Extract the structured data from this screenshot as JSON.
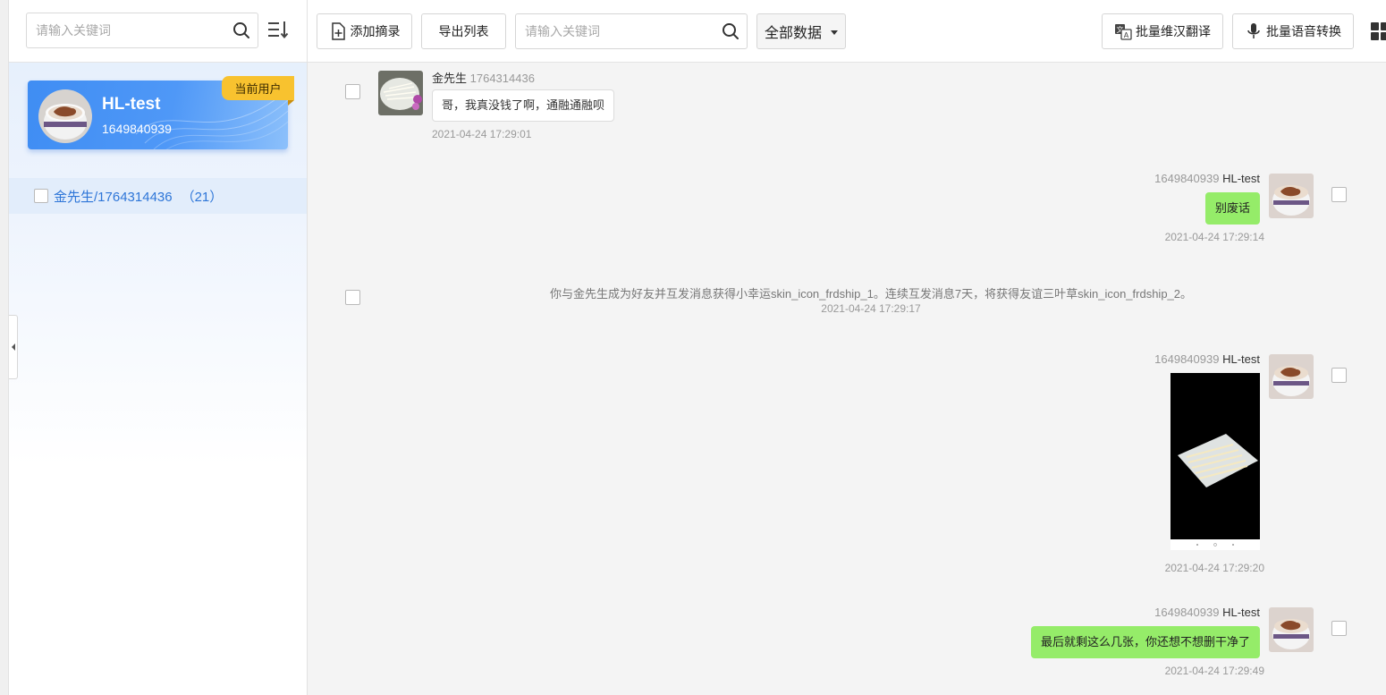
{
  "sidebar": {
    "search_placeholder": "请输入关键词",
    "current_user": {
      "name": "HL-test",
      "id": "1649840939",
      "badge": "当前用户"
    },
    "contacts": [
      {
        "label": "金先生/1764314436",
        "count": "（21）"
      }
    ]
  },
  "toolbar": {
    "add_excerpt": "添加摘录",
    "export_list": "导出列表",
    "search_placeholder": "请输入关键词",
    "filter_selected": "全部数据",
    "batch_translate": "批量维汉翻译",
    "batch_voice": "批量语音转换"
  },
  "messages": {
    "m1": {
      "sender_name": "金先生",
      "sender_id": "1764314436",
      "text": "哥，我真没钱了啊，通融通融呗",
      "time": "2021-04-24 17:29:01"
    },
    "m2": {
      "sender_id": "1649840939",
      "sender_name": "HL-test",
      "text": "别废话",
      "time": "2021-04-24 17:29:14"
    },
    "m3": {
      "text": "你与金先生成为好友并互发消息获得小幸运skin_icon_frdship_1。连续互发消息7天，将获得友谊三叶草skin_icon_frdship_2。",
      "time": "2021-04-24 17:29:17"
    },
    "m4": {
      "sender_id": "1649840939",
      "sender_name": "HL-test",
      "time": "2021-04-24 17:29:20"
    },
    "m5": {
      "sender_id": "1649840939",
      "sender_name": "HL-test",
      "text": "最后就剩这么几张，你还想不想删干净了",
      "time": "2021-04-24 17:29:49"
    }
  },
  "colors": {
    "accent": "#3f8df3",
    "badge": "#f8c22f",
    "bubble_out": "#95ec69",
    "contact_link": "#2e76d8"
  }
}
